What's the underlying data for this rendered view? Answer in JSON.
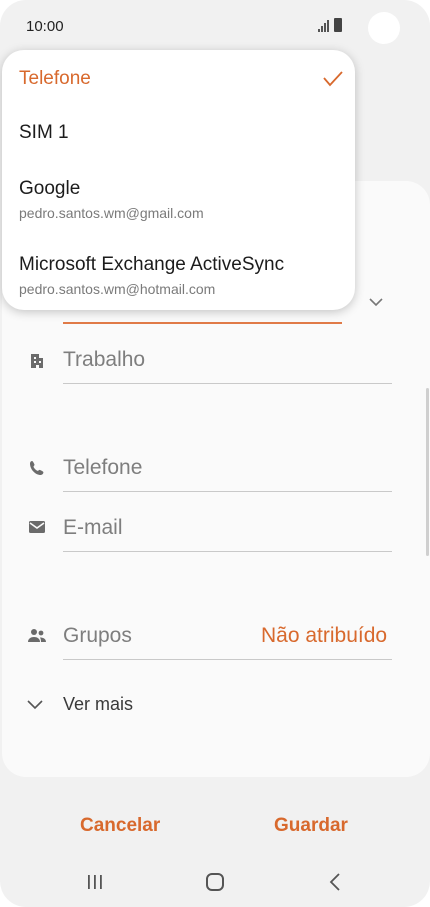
{
  "status_bar": {
    "time": "10:00"
  },
  "account_menu": {
    "options": [
      {
        "title": "Telefone",
        "selected": true
      },
      {
        "title": "SIM 1"
      },
      {
        "title": "Google",
        "subtitle": "pedro.santos.wm@gmail.com"
      },
      {
        "title": "Microsoft Exchange ActiveSync",
        "subtitle": "pedro.santos.wm@hotmail.com"
      }
    ]
  },
  "form": {
    "work_placeholder": "Trabalho",
    "phone_placeholder": "Telefone",
    "email_placeholder": "E-mail",
    "groups_label": "Grupos",
    "groups_value": "Não atribuído",
    "see_more": "Ver mais"
  },
  "actions": {
    "cancel": "Cancelar",
    "save": "Guardar"
  },
  "colors": {
    "accent": "#d8692d",
    "card": "#fafafa",
    "background": "#f1f1f1"
  },
  "icons": [
    "building-icon",
    "phone-icon",
    "mail-icon",
    "group-icon",
    "chevron-down-icon",
    "check-icon",
    "recent-apps-icon",
    "home-icon",
    "back-icon"
  ]
}
